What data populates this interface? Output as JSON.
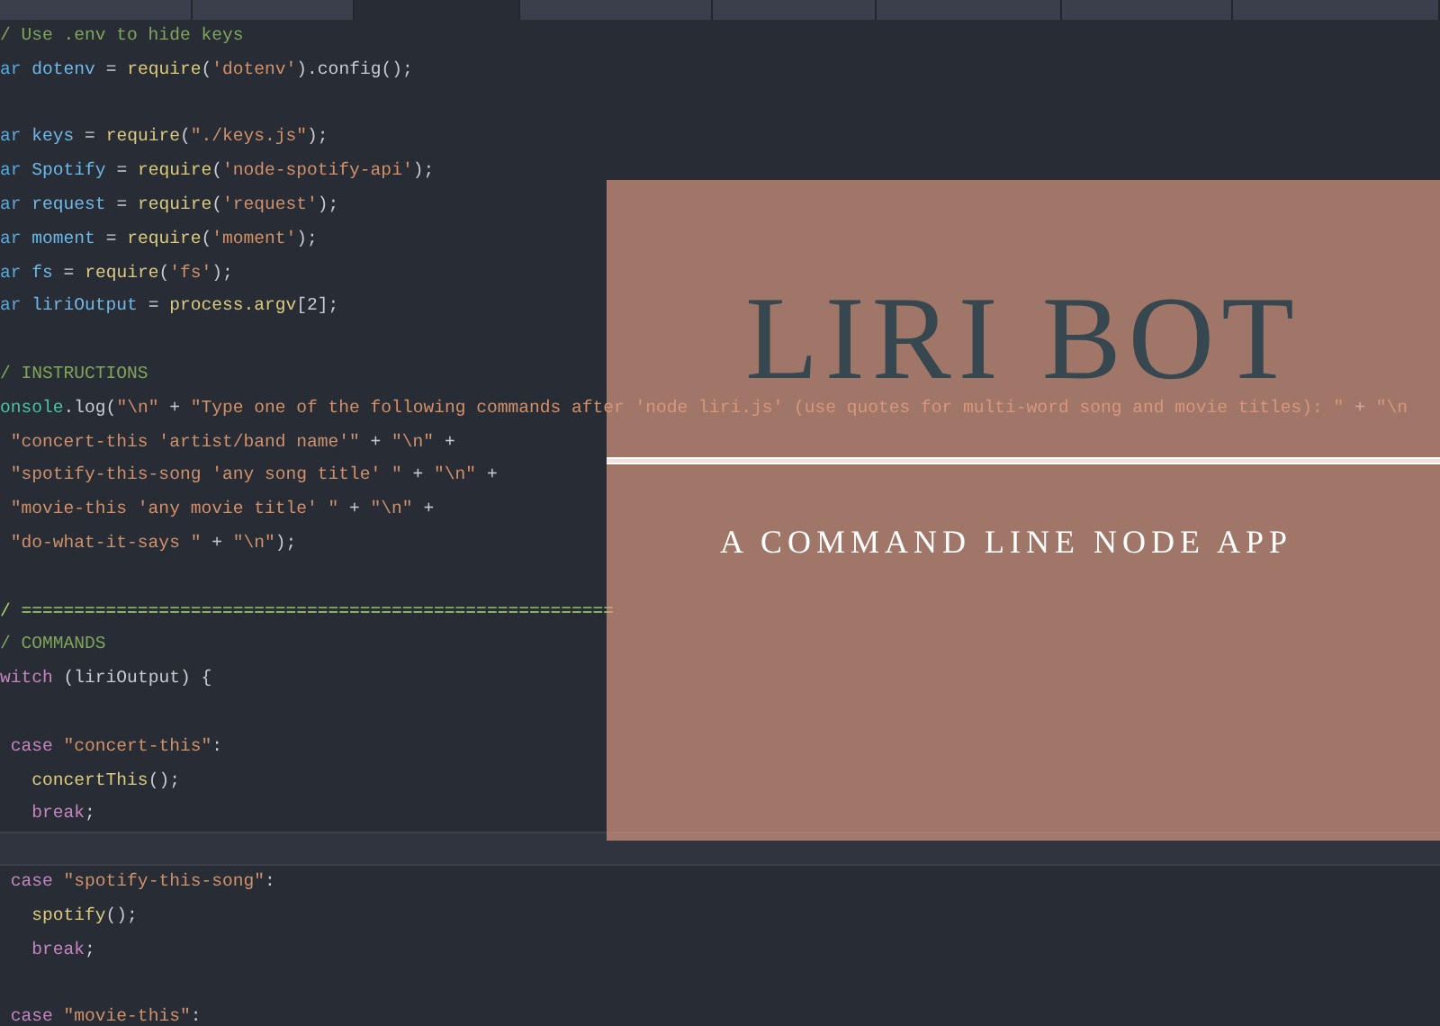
{
  "tabs": [
    {
      "selected": false
    },
    {
      "selected": false
    },
    {
      "selected": true
    },
    {
      "selected": false
    },
    {
      "selected": false
    },
    {
      "selected": false
    },
    {
      "selected": false
    },
    {
      "selected": false
    }
  ],
  "code_lines": [
    {
      "current": false,
      "tokens": [
        {
          "kind": "comment",
          "text": "/ Use .env to hide keys"
        }
      ]
    },
    {
      "current": false,
      "tokens": [
        {
          "kind": "keyword",
          "text": "ar"
        },
        {
          "kind": "variable",
          "text": " dotenv "
        },
        {
          "kind": "punct",
          "text": "= "
        },
        {
          "kind": "function",
          "text": "require"
        },
        {
          "kind": "punct",
          "text": "("
        },
        {
          "kind": "string",
          "text": "'dotenv'"
        },
        {
          "kind": "punct",
          "text": ").config();"
        }
      ]
    },
    {
      "current": false
    },
    {
      "current": false,
      "tokens": [
        {
          "kind": "keyword",
          "text": "ar"
        },
        {
          "kind": "variable",
          "text": " keys "
        },
        {
          "kind": "punct",
          "text": "= "
        },
        {
          "kind": "function",
          "text": "require"
        },
        {
          "kind": "punct",
          "text": "("
        },
        {
          "kind": "string",
          "text": "\"./keys.js\""
        },
        {
          "kind": "punct",
          "text": ");"
        }
      ]
    },
    {
      "current": false,
      "tokens": [
        {
          "kind": "keyword",
          "text": "ar"
        },
        {
          "kind": "variable",
          "text": " Spotify "
        },
        {
          "kind": "punct",
          "text": "= "
        },
        {
          "kind": "function",
          "text": "require"
        },
        {
          "kind": "punct",
          "text": "("
        },
        {
          "kind": "string",
          "text": "'node-spotify-api'"
        },
        {
          "kind": "punct",
          "text": ");"
        }
      ]
    },
    {
      "current": false,
      "tokens": [
        {
          "kind": "keyword",
          "text": "ar"
        },
        {
          "kind": "variable",
          "text": " request "
        },
        {
          "kind": "punct",
          "text": "= "
        },
        {
          "kind": "function",
          "text": "require"
        },
        {
          "kind": "punct",
          "text": "("
        },
        {
          "kind": "string",
          "text": "'request'"
        },
        {
          "kind": "punct",
          "text": ");"
        }
      ]
    },
    {
      "current": false,
      "tokens": [
        {
          "kind": "keyword",
          "text": "ar"
        },
        {
          "kind": "variable",
          "text": " moment "
        },
        {
          "kind": "punct",
          "text": "= "
        },
        {
          "kind": "function",
          "text": "require"
        },
        {
          "kind": "punct",
          "text": "("
        },
        {
          "kind": "string",
          "text": "'moment'"
        },
        {
          "kind": "punct",
          "text": ");"
        }
      ]
    },
    {
      "current": false,
      "tokens": [
        {
          "kind": "keyword",
          "text": "ar"
        },
        {
          "kind": "variable",
          "text": " fs "
        },
        {
          "kind": "punct",
          "text": "= "
        },
        {
          "kind": "function",
          "text": "require"
        },
        {
          "kind": "punct",
          "text": "("
        },
        {
          "kind": "string",
          "text": "'fs'"
        },
        {
          "kind": "punct",
          "text": ");"
        }
      ]
    },
    {
      "current": false,
      "tokens": [
        {
          "kind": "keyword",
          "text": "ar"
        },
        {
          "kind": "variable",
          "text": " liriOutput "
        },
        {
          "kind": "punct",
          "text": "= "
        },
        {
          "kind": "function",
          "text": "process.argv"
        },
        {
          "kind": "punct",
          "text": "[2];"
        }
      ]
    },
    {
      "current": false
    },
    {
      "current": false,
      "tokens": [
        {
          "kind": "comment",
          "text": "/ INSTRUCTIONS"
        }
      ]
    },
    {
      "current": false,
      "tokens": [
        {
          "kind": "object",
          "text": "onsole"
        },
        {
          "kind": "punct",
          "text": ".log("
        },
        {
          "kind": "string",
          "text": "\"\\n\""
        },
        {
          "kind": "punct",
          "text": " + "
        },
        {
          "kind": "string",
          "text": "\"Type one of the following commands after 'node liri.js' (use quotes for multi-word song and movie titles): \""
        },
        {
          "kind": "punct",
          "text": " + "
        },
        {
          "kind": "string",
          "text": "\"\\n"
        }
      ]
    },
    {
      "current": false,
      "tokens": [
        {
          "kind": "string",
          "text": " \"concert-this 'artist/band name'\""
        },
        {
          "kind": "punct",
          "text": " + "
        },
        {
          "kind": "string",
          "text": "\"\\n\""
        },
        {
          "kind": "punct",
          "text": " +"
        }
      ]
    },
    {
      "current": false,
      "tokens": [
        {
          "kind": "string",
          "text": " \"spotify-this-song 'any song title' \""
        },
        {
          "kind": "punct",
          "text": " + "
        },
        {
          "kind": "string",
          "text": "\"\\n\""
        },
        {
          "kind": "punct",
          "text": " +"
        }
      ]
    },
    {
      "current": false,
      "tokens": [
        {
          "kind": "string",
          "text": " \"movie-this 'any movie title' \""
        },
        {
          "kind": "punct",
          "text": " + "
        },
        {
          "kind": "string",
          "text": "\"\\n\""
        },
        {
          "kind": "punct",
          "text": " +"
        }
      ]
    },
    {
      "current": false,
      "tokens": [
        {
          "kind": "string",
          "text": " \"do-what-it-says \""
        },
        {
          "kind": "punct",
          "text": " + "
        },
        {
          "kind": "string",
          "text": "\"\\n\""
        },
        {
          "kind": "punct",
          "text": ");"
        }
      ]
    },
    {
      "current": false
    },
    {
      "current": false,
      "tokens": [
        {
          "kind": "rule",
          "text": "/ ========================================================"
        }
      ]
    },
    {
      "current": false,
      "tokens": [
        {
          "kind": "comment",
          "text": "/ COMMANDS"
        }
      ]
    },
    {
      "current": false,
      "tokens": [
        {
          "kind": "keyword2",
          "text": "witch"
        },
        {
          "kind": "punct",
          "text": " (liriOutput) {"
        }
      ]
    },
    {
      "current": false
    },
    {
      "current": false,
      "tokens": [
        {
          "kind": "keyword2",
          "text": " case "
        },
        {
          "kind": "string",
          "text": "\"concert-this\""
        },
        {
          "kind": "punct",
          "text": ":"
        }
      ]
    },
    {
      "current": false,
      "tokens": [
        {
          "kind": "function",
          "text": "   concertThis"
        },
        {
          "kind": "punct",
          "text": "();"
        }
      ]
    },
    {
      "current": false,
      "tokens": [
        {
          "kind": "keyword2",
          "text": "   break"
        },
        {
          "kind": "punct",
          "text": ";"
        }
      ]
    },
    {
      "current": true
    },
    {
      "current": false,
      "tokens": [
        {
          "kind": "keyword2",
          "text": " case "
        },
        {
          "kind": "string",
          "text": "\"spotify-this-song\""
        },
        {
          "kind": "punct",
          "text": ":"
        }
      ]
    },
    {
      "current": false,
      "tokens": [
        {
          "kind": "function",
          "text": "   spotify"
        },
        {
          "kind": "punct",
          "text": "();"
        }
      ]
    },
    {
      "current": false,
      "tokens": [
        {
          "kind": "keyword2",
          "text": "   break"
        },
        {
          "kind": "punct",
          "text": ";"
        }
      ]
    },
    {
      "current": false
    },
    {
      "current": false,
      "tokens": [
        {
          "kind": "keyword2",
          "text": " case "
        },
        {
          "kind": "string",
          "text": "\"movie-this\""
        },
        {
          "kind": "punct",
          "text": ":"
        }
      ]
    }
  ],
  "banner": {
    "title": "LIRI BOT",
    "subtitle": "A COMMAND LINE NODE APP"
  }
}
